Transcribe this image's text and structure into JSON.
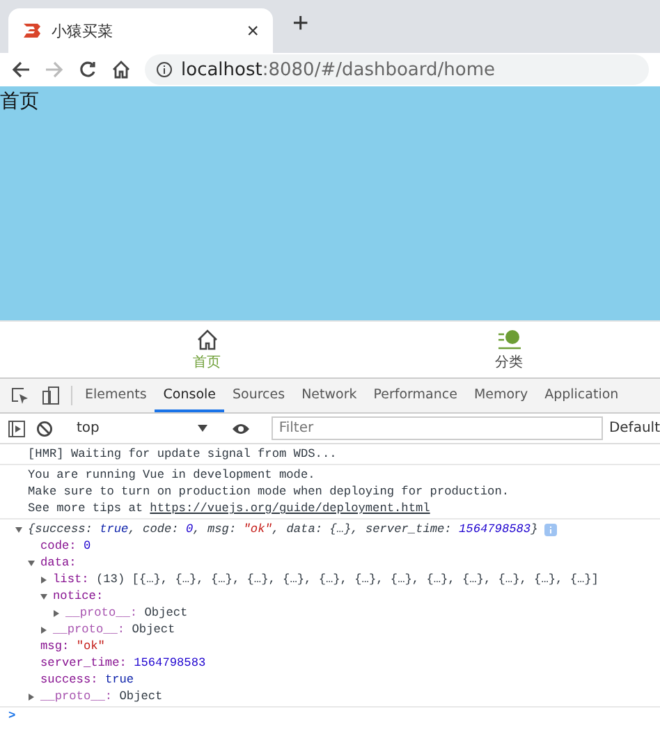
{
  "browser_tab": {
    "title": "小猿买菜",
    "close": "×",
    "new_tab": "+"
  },
  "address_bar": {
    "url_host": "localhost",
    "url_rest": ":8080/#/dashboard/home",
    "forward_disabled": true
  },
  "page": {
    "heading": "首页"
  },
  "bottom_nav": [
    {
      "label": "首页",
      "selected": true
    },
    {
      "label": "分类",
      "selected": false
    }
  ],
  "devtools": {
    "tabs": [
      {
        "label": "Elements",
        "selected": false
      },
      {
        "label": "Console",
        "selected": true
      },
      {
        "label": "Sources",
        "selected": false
      },
      {
        "label": "Network",
        "selected": false
      },
      {
        "label": "Performance",
        "selected": false
      },
      {
        "label": "Memory",
        "selected": false
      },
      {
        "label": "Application",
        "selected": false
      }
    ],
    "context": "top",
    "filter_placeholder": "Filter",
    "levels": "Default"
  },
  "console": {
    "messages": [
      {
        "kind": "text",
        "lines": [
          {
            "text": "[HMR] Waiting for update signal from WDS..."
          }
        ]
      },
      {
        "kind": "text",
        "lines": [
          {
            "text": "You are running Vue in development mode."
          },
          {
            "text": "Make sure to turn on production mode when deploying for production."
          },
          {
            "text": "See more tips at ",
            "link": "https://vuejs.org/guide/deployment.html"
          }
        ]
      },
      {
        "kind": "object",
        "expanded": true,
        "summary": [
          {
            "text": "{success: ",
            "kind": "plain"
          },
          {
            "text": "true",
            "kind": "keyword"
          },
          {
            "text": ", code: ",
            "kind": "plain"
          },
          {
            "text": "0",
            "kind": "number"
          },
          {
            "text": ", msg: ",
            "kind": "plain"
          },
          {
            "text": "\"ok\"",
            "kind": "string"
          },
          {
            "text": ", data: {…}, server_time: ",
            "kind": "plain"
          },
          {
            "text": "1564798583",
            "kind": "number"
          },
          {
            "text": "}",
            "kind": "plain"
          }
        ],
        "tree": [
          {
            "key": "code:",
            "internal": false,
            "value": "0",
            "kind": "number"
          },
          {
            "key": "data:",
            "internal": false,
            "expanded": true,
            "children": [
              {
                "key": "list:",
                "internal": false,
                "value": "(13) [{…}, {…}, {…}, {…}, {…}, {…}, {…}, {…}, {…}, {…}, {…}, {…}, {…}]",
                "kind": "plain",
                "expanded": false
              },
              {
                "key": "notice:",
                "internal": false,
                "expanded": true,
                "children": [
                  {
                    "key": "__proto__:",
                    "internal": true,
                    "value": "Object",
                    "kind": "plain",
                    "expanded": false
                  }
                ]
              },
              {
                "key": "__proto__:",
                "internal": true,
                "value": "Object",
                "kind": "plain",
                "expanded": false
              }
            ]
          },
          {
            "key": "msg:",
            "internal": false,
            "value": "\"ok\"",
            "kind": "string"
          },
          {
            "key": "server_time:",
            "internal": false,
            "value": "1564798583",
            "kind": "number"
          },
          {
            "key": "success:",
            "internal": false,
            "value": "true",
            "kind": "keyword"
          },
          {
            "key": "__proto__:",
            "internal": true,
            "value": "Object",
            "kind": "plain",
            "expanded": false
          }
        ]
      }
    ],
    "prompt": ">"
  }
}
